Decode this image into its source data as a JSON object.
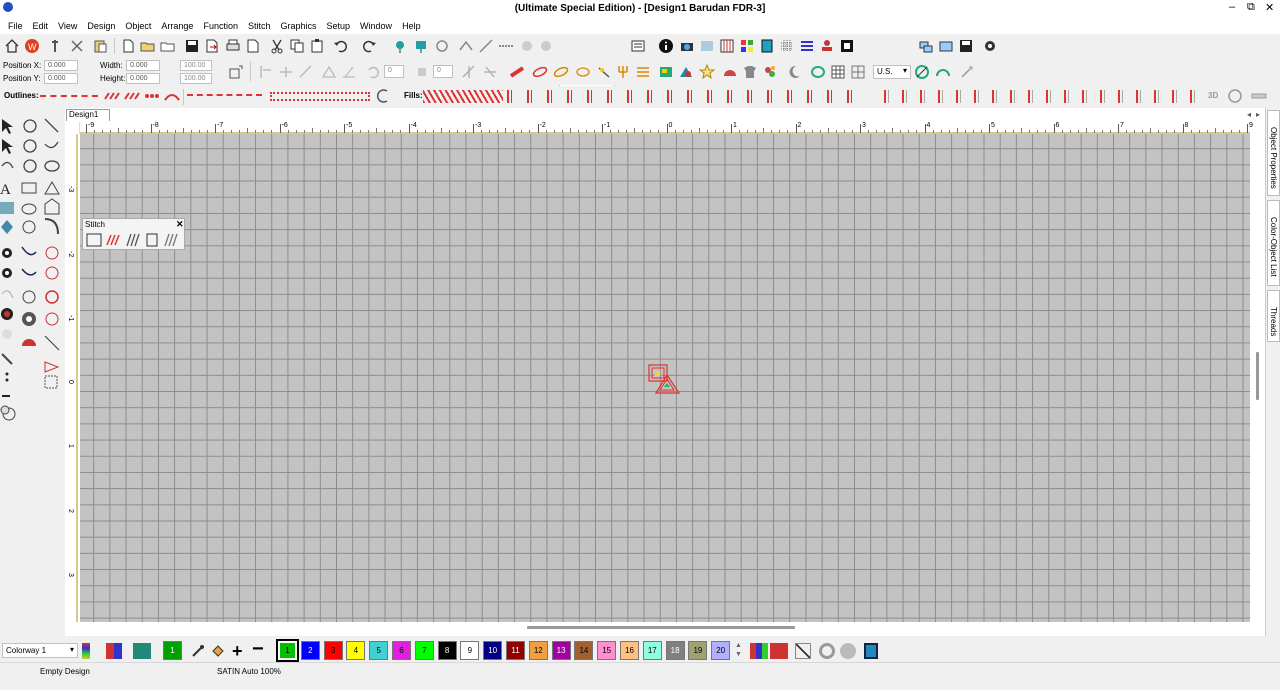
{
  "window": {
    "title": "(Ultimate Special Edition) - [Design1      Barudan FDR-3]",
    "minimize": "–",
    "restore": "⧉",
    "close": "✕"
  },
  "menu": [
    "File",
    "Edit",
    "View",
    "Design",
    "Object",
    "Arrange",
    "Function",
    "Stitch",
    "Graphics",
    "Setup",
    "Window",
    "Help"
  ],
  "toolbar": {
    "zoom_value": "100",
    "zoom_unit": "%",
    "units_value": "U.S."
  },
  "properties": {
    "position_x_label": "Position X:",
    "position_x_value": "0.000",
    "position_y_label": "Position Y:",
    "position_y_value": "0.000",
    "width_label": "Width:",
    "width_value": "0.000",
    "height_label": "Height:",
    "height_value": "0.000",
    "scale_w": "100.00",
    "scale_h": "100.00",
    "rotate_value": "0",
    "slant_value": "0"
  },
  "stitch_bar": {
    "outlines_label": "Outlines:",
    "fills_label": "Fills:",
    "three_d": "3D"
  },
  "document": {
    "tab_label": "Design1"
  },
  "ruler": {
    "h_ticks": [
      "-9",
      "-8",
      "-7",
      "-6",
      "-5",
      "-4",
      "-3",
      "-2",
      "-1",
      "0",
      "1",
      "2",
      "3",
      "4",
      "5",
      "6",
      "7",
      "8",
      "9"
    ],
    "v_ticks": [
      "-3",
      "-2",
      "-1",
      "0",
      "1",
      "2",
      "3"
    ]
  },
  "stitch_panel": {
    "title": "Stitch"
  },
  "side_tabs": [
    "Object Properties",
    "Color-Object List",
    "Threads"
  ],
  "bottom": {
    "colorway": "Colorway 1",
    "swatches": [
      {
        "n": "1",
        "c": "#00a000"
      },
      {
        "n": "1",
        "c": "#00c000"
      },
      {
        "n": "2",
        "c": "#0000ff"
      },
      {
        "n": "3",
        "c": "#ff0000"
      },
      {
        "n": "4",
        "c": "#ffff00"
      },
      {
        "n": "5",
        "c": "#40d0d0"
      },
      {
        "n": "6",
        "c": "#e020e0"
      },
      {
        "n": "7",
        "c": "#00ff00"
      },
      {
        "n": "8",
        "c": "#000000"
      },
      {
        "n": "9",
        "c": "#ffffff"
      },
      {
        "n": "10",
        "c": "#000080"
      },
      {
        "n": "11",
        "c": "#900000"
      },
      {
        "n": "12",
        "c": "#f0a040"
      },
      {
        "n": "13",
        "c": "#a000a0"
      },
      {
        "n": "14",
        "c": "#a06030"
      },
      {
        "n": "15",
        "c": "#ff90d0"
      },
      {
        "n": "16",
        "c": "#ffc080"
      },
      {
        "n": "17",
        "c": "#90ffe0"
      },
      {
        "n": "18",
        "c": "#808080"
      },
      {
        "n": "19",
        "c": "#a0a070"
      },
      {
        "n": "20",
        "c": "#b0b0ff"
      }
    ]
  },
  "status": {
    "left": "Empty Design",
    "middle": "SATIN Auto 100%"
  }
}
